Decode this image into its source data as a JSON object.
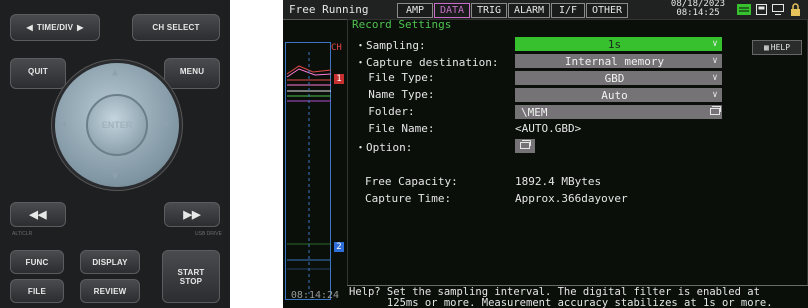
{
  "keypad": {
    "time_div": "TIME/DIV",
    "ch_select": "CH SELECT",
    "quit": "QUIT",
    "menu": "MENU",
    "enter": "ENTER",
    "alt_clr": "ALT/CLR",
    "usb_drive": "USB DRIVE",
    "func": "FUNC",
    "display": "DISPLAY",
    "file": "FILE",
    "review": "REVIEW",
    "start_stop_1": "START",
    "start_stop_2": "STOP"
  },
  "topbar": {
    "mode": "Free Running",
    "tabs": [
      {
        "label": "AMP",
        "active": false
      },
      {
        "label": "DATA",
        "active": true
      },
      {
        "label": "TRIG",
        "active": false
      },
      {
        "label": "ALARM",
        "active": false
      },
      {
        "label": "I/F",
        "active": false
      },
      {
        "label": "OTHER",
        "active": false
      }
    ],
    "date": "08/18/2023",
    "time": "08:14:25",
    "icons": [
      "battery-icon",
      "card-icon",
      "pc-link-icon",
      "lock-icon"
    ]
  },
  "strip": {
    "ch_label": "CH",
    "ch1": "1",
    "ch2": "2",
    "time": "08:14:24"
  },
  "settings": {
    "section_title": "Record Settings",
    "help_button": "HELP",
    "rows": [
      {
        "label": "・Sampling:",
        "value": "1s",
        "kind": "dropdown-green"
      },
      {
        "label": "・Capture destination:",
        "value": "Internal memory",
        "kind": "dropdown"
      },
      {
        "label": "  File Type:",
        "value": "GBD",
        "kind": "dropdown"
      },
      {
        "label": "  Name Type:",
        "value": "Auto",
        "kind": "dropdown"
      },
      {
        "label": "  Folder:",
        "value": "\\MEM",
        "kind": "browse"
      },
      {
        "label": "  File Name:",
        "value": "<AUTO.GBD>",
        "kind": "text"
      },
      {
        "label": "・Option:",
        "value": "",
        "kind": "button"
      }
    ],
    "free_capacity_label": "Free Capacity:",
    "free_capacity_value": "1892.4 MBytes",
    "capture_time_label": "Capture Time:",
    "capture_time_value": "Approx.366dayover"
  },
  "help": {
    "line1": "Help? Set the sampling interval. The digital filter is enabled at",
    "line2": "      125ms or more. Measurement accuracy stabilizes at 1s or more."
  },
  "colors": {
    "accent_green": "#37c12f",
    "tab_active": "#c86ec8",
    "field_gray": "#757375"
  }
}
